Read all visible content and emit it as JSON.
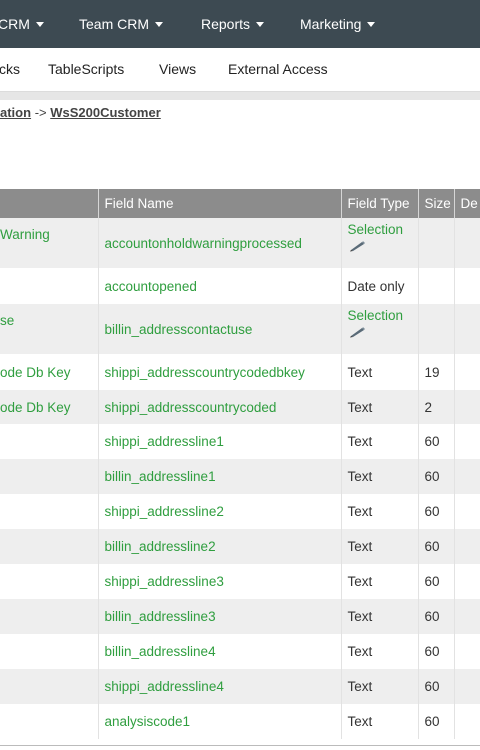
{
  "topnav": {
    "items": [
      {
        "label": "CRM"
      },
      {
        "label": "Team CRM"
      },
      {
        "label": "Reports"
      },
      {
        "label": "Marketing"
      }
    ]
  },
  "subnav": {
    "items": [
      {
        "label": "cks"
      },
      {
        "label": "TableScripts"
      },
      {
        "label": "Views"
      },
      {
        "label": "External Access"
      }
    ]
  },
  "breadcrumb": {
    "parent": "ation",
    "separator": "->",
    "current": "WsS200Customer"
  },
  "table": {
    "headers": [
      "",
      "Field Name",
      "Field Type",
      "Size",
      "De"
    ],
    "rows": [
      {
        "label": "Warning",
        "field": "accountonholdwarningprocessed",
        "type": "Selection",
        "editable": true,
        "size": "",
        "tall": true
      },
      {
        "label": "",
        "field": "accountopened",
        "type": "Date only",
        "editable": false,
        "size": "",
        "tall": false
      },
      {
        "label": "se",
        "field": "billin_addresscontactuse",
        "type": "Selection",
        "editable": true,
        "size": "",
        "tall": true
      },
      {
        "label": "ode Db Key",
        "field": "shippi_addresscountrycodedbkey",
        "type": "Text",
        "editable": false,
        "size": "19",
        "tall": false
      },
      {
        "label": "ode Db Key",
        "field": "shippi_addresscountrycoded",
        "type": "Text",
        "editable": false,
        "size": "2",
        "tall": false
      },
      {
        "label": "",
        "field": "shippi_addressline1",
        "type": "Text",
        "editable": false,
        "size": "60",
        "tall": false
      },
      {
        "label": "",
        "field": "billin_addressline1",
        "type": "Text",
        "editable": false,
        "size": "60",
        "tall": false
      },
      {
        "label": "",
        "field": "shippi_addressline2",
        "type": "Text",
        "editable": false,
        "size": "60",
        "tall": false
      },
      {
        "label": "",
        "field": "billin_addressline2",
        "type": "Text",
        "editable": false,
        "size": "60",
        "tall": false
      },
      {
        "label": "",
        "field": "shippi_addressline3",
        "type": "Text",
        "editable": false,
        "size": "60",
        "tall": false
      },
      {
        "label": "",
        "field": "billin_addressline3",
        "type": "Text",
        "editable": false,
        "size": "60",
        "tall": false
      },
      {
        "label": "",
        "field": "billin_addressline4",
        "type": "Text",
        "editable": false,
        "size": "60",
        "tall": false
      },
      {
        "label": "",
        "field": "shippi_addressline4",
        "type": "Text",
        "editable": false,
        "size": "60",
        "tall": false
      },
      {
        "label": "",
        "field": "analysiscode1",
        "type": "Text",
        "editable": false,
        "size": "60",
        "tall": false
      }
    ]
  },
  "icons": {
    "dropdown": "chevron-down-icon",
    "edit": "pencil-icon"
  },
  "colors": {
    "nav_bg": "#3d4a52",
    "header_bg": "#8c8c8c",
    "link_green": "#2f9e3f",
    "row_alt": "#eeeeee"
  }
}
